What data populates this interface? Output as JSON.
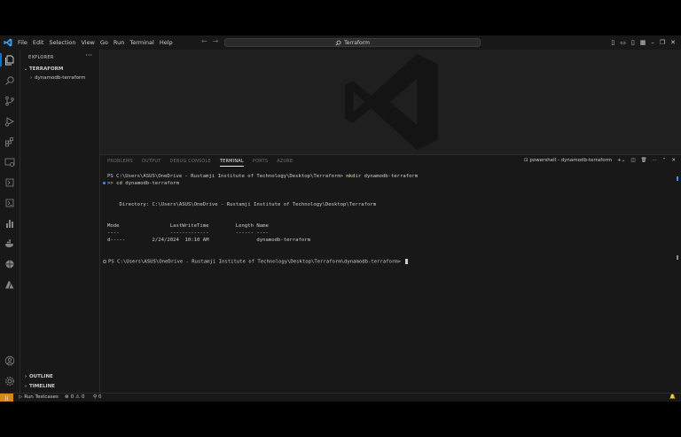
{
  "menu": [
    "File",
    "Edit",
    "Selection",
    "View",
    "Go",
    "Run",
    "Terminal",
    "Help"
  ],
  "search": {
    "text": "Terraform"
  },
  "sidebar": {
    "title": "EXPLORER",
    "root": "TERRAFORM",
    "folder": "dynamodb-terraform",
    "outline": "OUTLINE",
    "timeline": "TIMELINE"
  },
  "panel": {
    "tabs": [
      "PROBLEMS",
      "OUTPUT",
      "DEBUG CONSOLE",
      "TERMINAL",
      "PORTS",
      "AZURE"
    ],
    "active_tab": "TERMINAL",
    "terminal_name": "powershell - dynamodb-terraform"
  },
  "terminal": {
    "line1_prompt": "PS C:\\Users\\ASUS\\OneDrive - Rustamji Institute of Technology\\Desktop\\Terraform> ",
    "line1_cmd": "mkdir",
    "line1_arg": " dynamodb-terraform",
    "line2_prefix": ">> ",
    "line2_cmd": "cd",
    "line2_arg": " dynamodb-terraform",
    "directory": "    Directory: C:\\Users\\ASUS\\OneDrive - Rustamji Institute of Technology\\Desktop\\Terraform",
    "header": "Mode                 LastWriteTime         Length Name",
    "dashes": "----                 -------------         ------ ----",
    "row": "d-----         2/24/2024  10:10 AM                dynamodb-terraform",
    "final_prompt": "PS C:\\Users\\ASUS\\OneDrive - Rustamji Institute of Technology\\Desktop\\Terraform\\dynamodb-terraform> "
  },
  "status": {
    "run_testcases": "Run Testcases",
    "errors": "0",
    "warnings": "0",
    "ports": "0"
  },
  "colors": {
    "accent": "#0078d4",
    "remote": "#d48a14",
    "command": "#dcdcaa",
    "prompt_dot": "#3794ff"
  }
}
